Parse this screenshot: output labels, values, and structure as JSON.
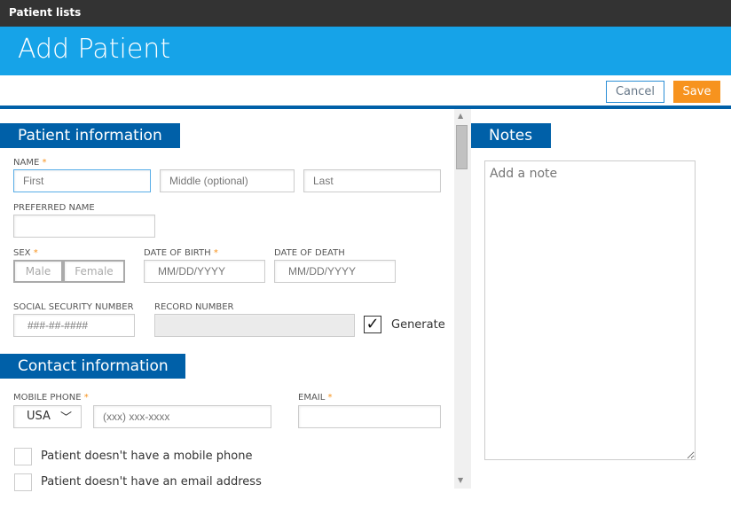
{
  "topbar": {
    "title": "Patient lists"
  },
  "header": {
    "title": "Add Patient"
  },
  "toolbar": {
    "cancel": "Cancel",
    "save": "Save"
  },
  "patient_info": {
    "title": "Patient information",
    "name_label": "NAME",
    "required": "*",
    "first_placeholder": "First",
    "middle_placeholder": "Middle (optional)",
    "last_placeholder": "Last",
    "preferred_label": "PREFERRED NAME",
    "sex_label": "SEX",
    "male": "Male",
    "female": "Female",
    "dob_label": "DATE OF BIRTH",
    "dob_placeholder": "MM/DD/YYYY",
    "dod_label": "DATE OF DEATH",
    "dod_placeholder": "MM/DD/YYYY",
    "ssn_label": "SOCIAL SECURITY NUMBER",
    "ssn_placeholder": "###-##-####",
    "record_label": "RECORD NUMBER",
    "generate": "Generate",
    "generate_checked": true
  },
  "contact_info": {
    "title": "Contact information",
    "mobile_label": "MOBILE PHONE",
    "country": "USA",
    "phone_placeholder": "(xxx) xxx-xxxx",
    "email_label": "EMAIL",
    "no_mobile": "Patient doesn't have a mobile phone",
    "no_email": "Patient doesn't have an email address"
  },
  "notes": {
    "title": "Notes",
    "placeholder": "Add a note"
  },
  "colors": {
    "accent": "#16a3e8",
    "section": "#0060a8",
    "save": "#f7931e"
  }
}
